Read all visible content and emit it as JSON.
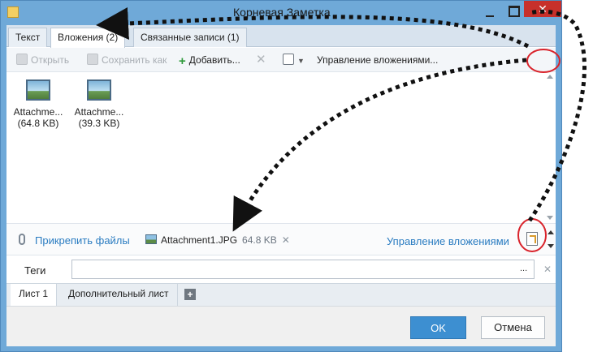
{
  "window": {
    "title": "Корневая Заметка",
    "close_glyph": "✕"
  },
  "tabs": [
    {
      "label": "Текст"
    },
    {
      "label": "Вложения (2)"
    },
    {
      "label": "Связанные записи  (1)"
    }
  ],
  "toolbar": {
    "open_label": "Открыть",
    "save_as_label": "Сохранить как",
    "add_label": "Добавить...",
    "manage_label": "Управление вложениями..."
  },
  "attachments": [
    {
      "name": "Attachme...",
      "size": "(64.8 KB)"
    },
    {
      "name": "Attachme...",
      "size": "(39.3 KB)"
    }
  ],
  "attach_bar": {
    "attach_files_label": "Прикрепить файлы",
    "file_name": "Attachment1.JPG",
    "file_size": "64.8 KB",
    "remove_glyph": "✕",
    "manage_label": "Управление вложениями"
  },
  "tags": {
    "label": "Теги",
    "value": "",
    "dots": "...",
    "clear_glyph": "✕"
  },
  "sheets": [
    {
      "label": "Лист 1"
    },
    {
      "label": "Дополнительный лист"
    }
  ],
  "sheet_add_glyph": "+",
  "footer": {
    "ok_label": "OK",
    "cancel_label": "Отмена"
  },
  "colors": {
    "accent": "#3d8fd1",
    "link": "#2a7cc1",
    "annotation_ring": "#d9232b"
  }
}
